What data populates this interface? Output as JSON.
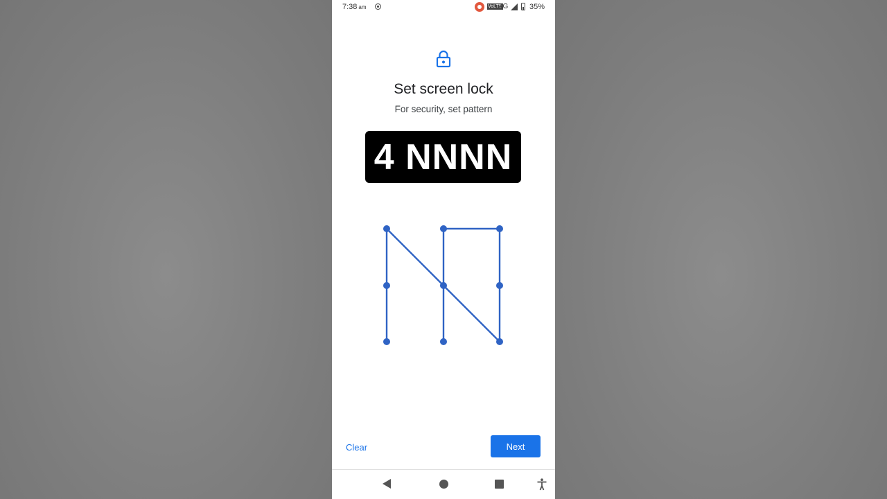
{
  "status_bar": {
    "time": "7:38",
    "ampm": "am",
    "volte": "VoLTE",
    "network": "4G",
    "battery": "35%"
  },
  "header": {
    "icon": "lock-icon",
    "title": "Set screen lock",
    "subtitle": "For security, set pattern"
  },
  "overlay": {
    "text": "4 NNNN"
  },
  "pattern": {
    "grid": "3x3",
    "sequence": [
      7,
      4,
      1,
      5,
      9,
      6,
      3,
      2,
      8
    ]
  },
  "actions": {
    "clear_label": "Clear",
    "next_label": "Next"
  },
  "nav_bar": {
    "icons": [
      "back-icon",
      "home-icon",
      "recents-icon",
      "accessibility-icon"
    ]
  },
  "colors": {
    "accent": "#1a73e8",
    "pattern_line": "#2f63c4",
    "background": "#808080"
  }
}
